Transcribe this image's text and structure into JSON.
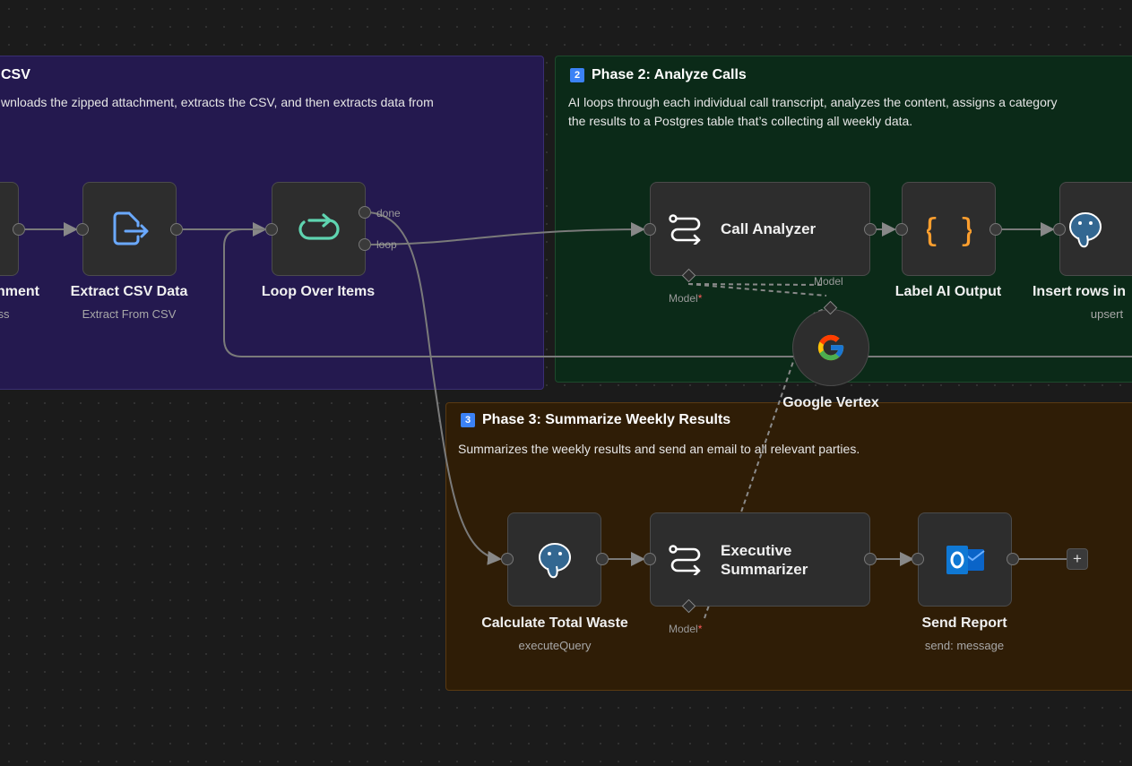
{
  "stickies": {
    "phase1": {
      "title": "CSV",
      "body": "wnloads the zipped attachment, extracts the CSV, and then extracts data from"
    },
    "phase2": {
      "badge": "2",
      "title": "Phase 2: Analyze Calls",
      "line1": "AI loops through each individual call transcript, analyzes the content, assigns a category",
      "line2": "the results to a Postgres table that’s collecting all weekly data."
    },
    "phase3": {
      "badge": "3",
      "title": "Phase 3: Summarize Weekly Results",
      "body": "Summarizes the weekly results and send an email to all relevant parties."
    }
  },
  "nodes": {
    "attachment": {
      "label": "nment",
      "sub": "ss"
    },
    "extract_csv": {
      "label": "Extract CSV Data",
      "sub": "Extract From CSV",
      "icon": "file-export-icon"
    },
    "loop": {
      "label": "Loop Over Items",
      "port_done": "done",
      "port_loop": "loop",
      "icon": "loop-icon"
    },
    "call_analyzer": {
      "label": "Call Analyzer",
      "model": "Model",
      "req": "*",
      "icon": "ai-chain-icon"
    },
    "label_ai": {
      "label": "Label AI Output",
      "icon": "braces-icon"
    },
    "insert_rows": {
      "label": "Insert rows in",
      "sub": "upsert",
      "icon": "postgres-icon"
    },
    "google_vertex": {
      "label": "Google Vertex",
      "model": "Model",
      "icon": "google-icon"
    },
    "calc_waste": {
      "label": "Calculate Total Waste",
      "sub": "executeQuery",
      "icon": "postgres-icon"
    },
    "exec_summarizer": {
      "label_line1": "Executive",
      "label_line2": "Summarizer",
      "model": "Model",
      "req": "*",
      "icon": "ai-chain-icon"
    },
    "send_report": {
      "label": "Send Report",
      "sub": "send: message",
      "icon": "outlook-icon"
    },
    "add": {
      "label": "+"
    }
  }
}
